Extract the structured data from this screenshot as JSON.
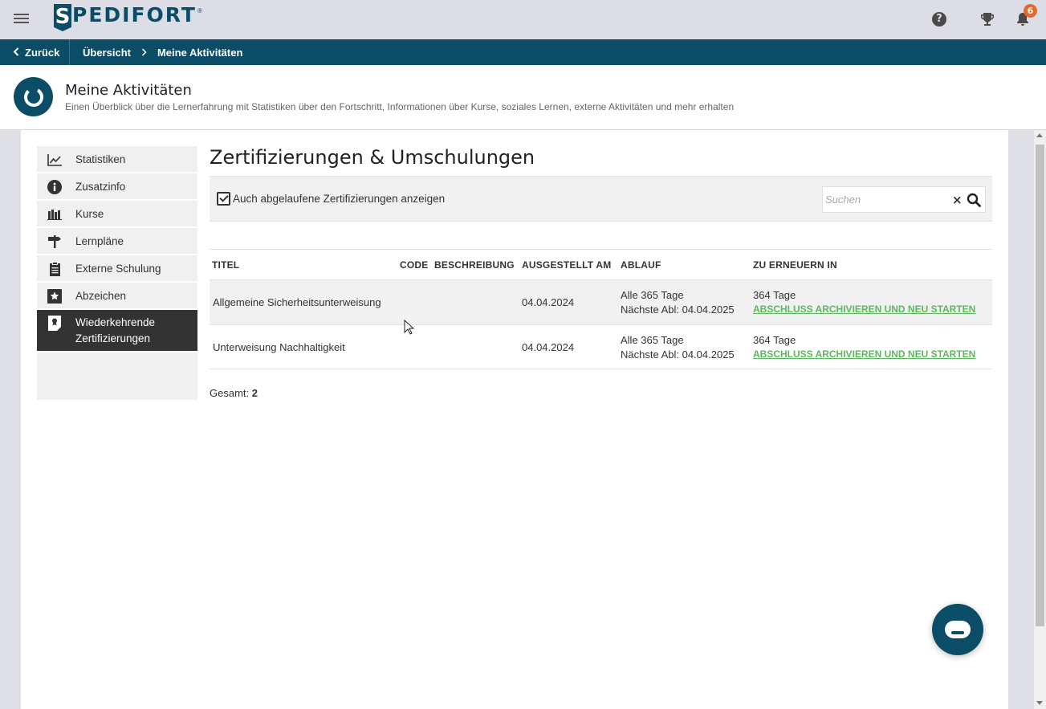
{
  "topbar": {
    "logo_initial": "S",
    "logo_text": "PEDIFORT",
    "logo_reg": "®",
    "help_glyph": "?",
    "notification_count": "6"
  },
  "breadcrumb": {
    "back_label": "Zurück",
    "items": [
      "Übersicht",
      "Meine Aktivitäten"
    ]
  },
  "header": {
    "title": "Meine Aktivitäten",
    "subtitle": "Einen Überblick über die Lernerfahrung mit Statistiken über den Fortschritt, Informationen über Kurse, soziales Lernen, externe Aktivitäten und mehr erhalten"
  },
  "sidebar": {
    "items": [
      {
        "label": "Statistiken",
        "icon": "chart-line-icon"
      },
      {
        "label": "Zusatzinfo",
        "icon": "info-circle-icon"
      },
      {
        "label": "Kurse",
        "icon": "books-icon"
      },
      {
        "label": "Lernpläne",
        "icon": "signpost-icon"
      },
      {
        "label": "Externe Schulung",
        "icon": "clipboard-icon"
      },
      {
        "label": "Abzeichen",
        "icon": "star-badge-icon"
      },
      {
        "label": "Wiederkehrende Zertifizierungen",
        "icon": "certificate-icon"
      }
    ],
    "active_index": 6
  },
  "main": {
    "title": "Zertifizierungen & Umschulungen",
    "filter": {
      "checkbox_label": "Auch abgelaufene Zertifizierungen anzeigen",
      "checked": true,
      "search_placeholder": "Suchen",
      "search_value": "",
      "clear_glyph": "×"
    },
    "table": {
      "headers": [
        "TITEL",
        "CODE",
        "BESCHREIBUNG",
        "AUSGESTELLT AM",
        "ABLAUF",
        "ZU ERNEUERN IN"
      ],
      "rows": [
        {
          "title": "Allgemeine Sicherheitsunterweisung",
          "code": "",
          "description": "",
          "issued": "04.04.2024",
          "expiry_period": "Alle 365 Tage",
          "next_expiry": "Nächste Abl: 04.04.2025",
          "renew_in": "364 Tage",
          "renew_action": "ABSCHLUSS ARCHIVIEREN UND NEU STARTEN"
        },
        {
          "title": "Unterweisung Nachhaltigkeit",
          "code": "",
          "description": "",
          "issued": "04.04.2024",
          "expiry_period": "Alle 365 Tage",
          "next_expiry": "Nächste Abl: 04.04.2025",
          "renew_in": "364 Tage",
          "renew_action": "ABSCHLUSS ARCHIVIEREN UND NEU STARTEN"
        }
      ]
    },
    "total_label": "Gesamt:",
    "total_value": "2"
  },
  "colors": {
    "brand": "#0b4d66",
    "link_green": "#5cb85c",
    "badge_orange": "#e8672a",
    "active_item": "#333333"
  }
}
